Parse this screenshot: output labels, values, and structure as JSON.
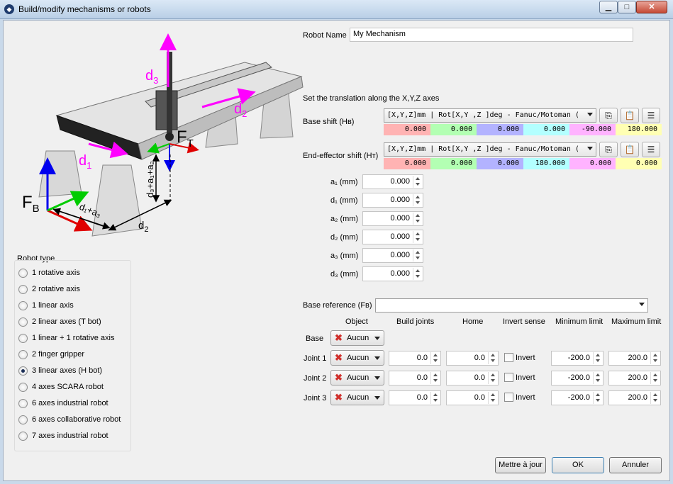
{
  "window": {
    "title": "Build/modify mechanisms or robots"
  },
  "colors": {
    "x": "#ffb3b3",
    "y": "#b3ffb3",
    "z": "#b3b3ff",
    "rx": "#b3ffff",
    "ry": "#ffb3ff",
    "rz": "#ffffb3"
  },
  "diagram": {
    "labels": {
      "d3": "d",
      "d3_sub": "3",
      "d2": "d",
      "d2_sub": "2",
      "d1": "d",
      "d1_sub": "1",
      "ft": "F",
      "ft_sub": "T",
      "fb": "F",
      "fb_sub": "B",
      "vert": "d₃+a₁+a₂",
      "diag": "d₁+a₃",
      "d2b": "d",
      "d2b_sub": "2"
    }
  },
  "robot_name": {
    "label": "Robot Name",
    "value": "My Mechanism"
  },
  "translation_header": "Set the translation along the X,Y,Z axes",
  "base_shift": {
    "label": "Base shift (Hв)",
    "format": "[X,Y,Z]mm | Rot[X,Y ,Z  ]deg - Fanuc/Motoman (",
    "values": [
      "0.000",
      "0.000",
      "0.000",
      "0.000",
      "-90.000",
      "180.000"
    ]
  },
  "tool_shift": {
    "label": "End-effector shift (Hт)",
    "format": "[X,Y,Z]mm | Rot[X,Y ,Z  ]deg - Fanuc/Motoman (",
    "values": [
      "0.000",
      "0.000",
      "0.000",
      "180.000",
      "0.000",
      "0.000"
    ]
  },
  "params": [
    {
      "label": "a₁ (mm)",
      "value": "0.000"
    },
    {
      "label": "d₁ (mm)",
      "value": "0.000"
    },
    {
      "label": "a₂ (mm)",
      "value": "0.000"
    },
    {
      "label": "d₂ (mm)",
      "value": "0.000"
    },
    {
      "label": "a₃ (mm)",
      "value": "0.000"
    },
    {
      "label": "d₃ (mm)",
      "value": "0.000"
    }
  ],
  "robot_type": {
    "title": "Robot type",
    "options": [
      "1 rotative axis",
      "2 rotative axis",
      "1 linear axis",
      "2 linear axes (T bot)",
      "1 linear + 1 rotative axis",
      "2 finger gripper",
      "3 linear axes (H bot)",
      "4 axes SCARA robot",
      "6 axes industrial robot",
      "6 axes collaborative robot",
      "7 axes industrial robot"
    ],
    "selected": "3 linear axes (H bot)"
  },
  "base_reference": {
    "label": "Base reference (Fв)",
    "value": ""
  },
  "joints_table": {
    "headers": {
      "object": "Object",
      "build": "Build joints",
      "home": "Home",
      "invert": "Invert sense",
      "min": "Minimum limit",
      "max": "Maximum limit"
    },
    "base": {
      "label": "Base",
      "object": "Aucun"
    },
    "rows": [
      {
        "label": "Joint 1",
        "object": "Aucun",
        "build": "0.0",
        "home": "0.0",
        "invert": "Invert",
        "min": "-200.0",
        "max": "200.0"
      },
      {
        "label": "Joint 2",
        "object": "Aucun",
        "build": "0.0",
        "home": "0.0",
        "invert": "Invert",
        "min": "-200.0",
        "max": "200.0"
      },
      {
        "label": "Joint 3",
        "object": "Aucun",
        "build": "0.0",
        "home": "0.0",
        "invert": "Invert",
        "min": "-200.0",
        "max": "200.0"
      }
    ]
  },
  "buttons": {
    "update": "Mettre à jour",
    "ok": "OK",
    "cancel": "Annuler"
  }
}
